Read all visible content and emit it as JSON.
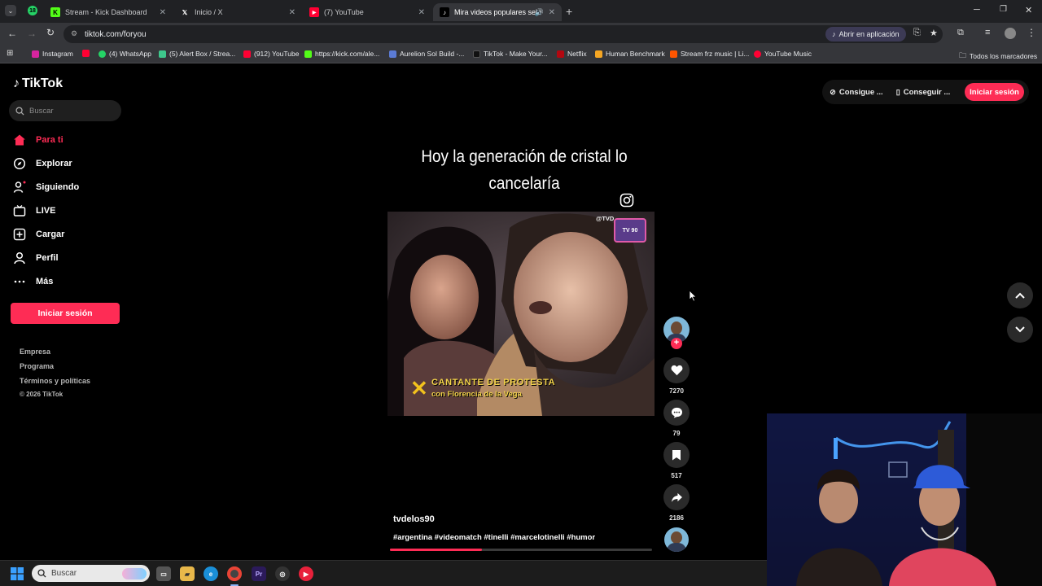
{
  "browser": {
    "tabs": [
      {
        "label": "Stream - Kick Dashboard"
      },
      {
        "label": "Inicio / X"
      },
      {
        "label": "(7) YouTube"
      },
      {
        "label": "Mira videos populares sele"
      }
    ],
    "address": "tiktok.com/foryou",
    "open_in_app": "Abrir en aplicación",
    "bookmarks": [
      "Instagram",
      "(4) WhatsApp",
      "(5) Alert Box / Strea...",
      "(912) YouTube",
      "https://kick.com/ale...",
      "Aurelion Sol Build -...",
      "TikTok - Make Your...",
      "Netflix",
      "Human Benchmark",
      "Stream frz music | Li...",
      "YouTube Music"
    ],
    "all_bookmarks": "Todos los marcadores"
  },
  "tiktok": {
    "logo": "TikTok",
    "search_placeholder": "Buscar",
    "nav": [
      {
        "label": "Para ti"
      },
      {
        "label": "Explorar"
      },
      {
        "label": "Siguiendo"
      },
      {
        "label": "LIVE"
      },
      {
        "label": "Cargar"
      },
      {
        "label": "Perfil"
      },
      {
        "label": "Más"
      }
    ],
    "login_label": "Iniciar sesión",
    "footer": [
      "Empresa",
      "Programa",
      "Términos y políticas",
      "© 2026 TikTok"
    ],
    "header": {
      "get_coins": "Consigue ...",
      "get_app": "Conseguir ...",
      "login": "Iniciar sesión"
    },
    "video": {
      "caption": "Hoy la generación de cristal lo cancelaría",
      "overlay_title": "CANTANTE DE PROTESTA",
      "overlay_subtitle": "con Florencia de la Vega",
      "watermark": "@TVD",
      "author": "tvdelos90",
      "hashtags": "#argentina #videomatch #tinelli #marcelotinelli #humor",
      "progress": 0.35
    },
    "actions": {
      "likes": "7270",
      "comments": "79",
      "saves": "517",
      "shares": "2186"
    }
  },
  "taskbar": {
    "search_placeholder": "Buscar"
  },
  "colors": {
    "accent": "#fe2c55",
    "background": "#000000",
    "chrome": "#202124"
  }
}
